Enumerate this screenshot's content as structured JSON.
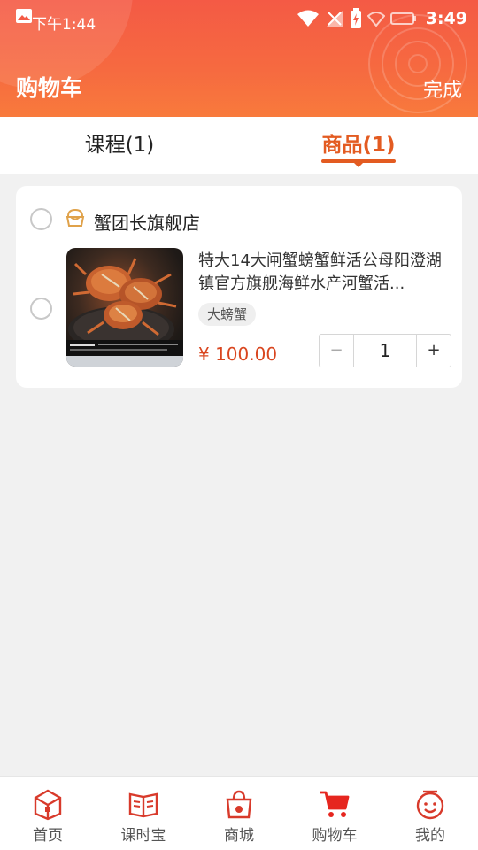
{
  "status_bar": {
    "time_left": "下午1:44",
    "clock": "3:49"
  },
  "header": {
    "title": "购物车",
    "done_label": "完成"
  },
  "tabs": [
    {
      "label": "课程(1)",
      "active": false
    },
    {
      "label": "商品(1)",
      "active": true
    }
  ],
  "cart": {
    "store": {
      "name": "蟹团长旗舰店",
      "icon": "store-icon"
    },
    "item": {
      "title": "特大14大闸蟹螃蟹鲜活公母阳澄湖镇官方旗舰海鲜水产河蟹活...",
      "tag": "大螃蟹",
      "price": "¥ 100.00",
      "quantity": "1",
      "minus": "−",
      "plus": "+"
    }
  },
  "bottom_nav": [
    {
      "label": "首页",
      "icon": "home-box-icon"
    },
    {
      "label": "课时宝",
      "icon": "book-icon"
    },
    {
      "label": "商城",
      "icon": "shopping-bag-icon"
    },
    {
      "label": "购物车",
      "icon": "cart-icon",
      "active": true
    },
    {
      "label": "我的",
      "icon": "smile-profile-icon"
    }
  ],
  "colors": {
    "accent": "#e35b21",
    "header_gradient_top": "#f45a45",
    "header_gradient_bottom": "#f87a3c",
    "price": "#d9461f",
    "nav_icon": "#d83a2b"
  }
}
